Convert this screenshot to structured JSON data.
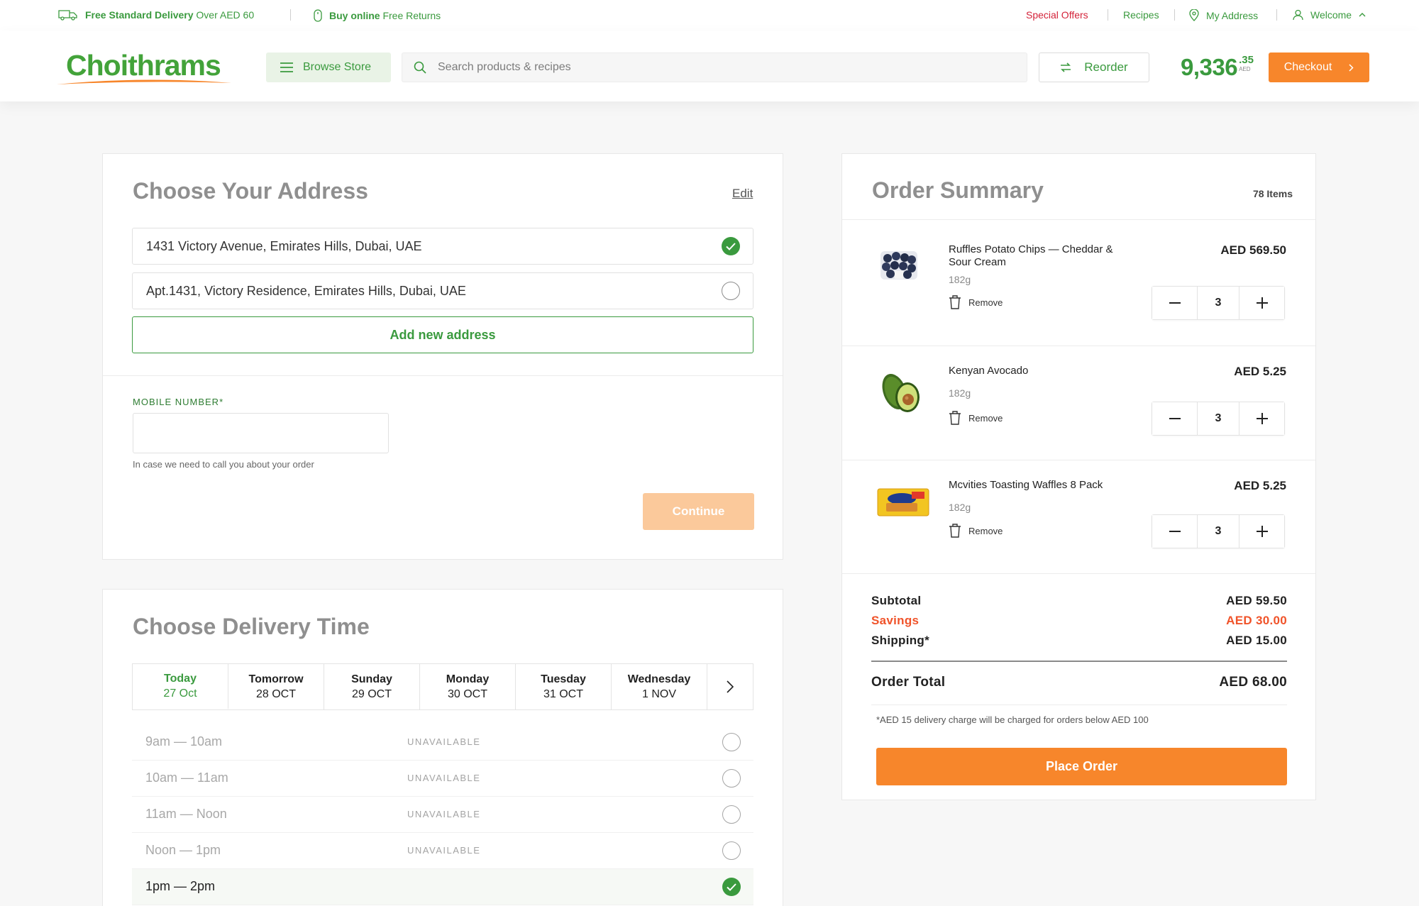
{
  "topbar": {
    "delivery_bold": "Free Standard Delivery",
    "delivery_rest": "Over AED 60",
    "returns_bold": "Buy online",
    "returns_rest": "Free Returns",
    "special_offers": "Special Offers",
    "recipes": "Recipes",
    "my_address": "My Address",
    "welcome": "Welcome"
  },
  "header": {
    "logo_text": "Choithrams",
    "browse_label": "Browse Store",
    "search_placeholder": "Search products & recipes",
    "reorder_label": "Reorder",
    "cart_amount": "9,336",
    "cart_cents": ".35",
    "cart_currency": "AED",
    "checkout_label": "Checkout"
  },
  "address": {
    "title": "Choose Your Address",
    "edit_label": "Edit",
    "options": [
      {
        "text": "1431 Victory Avenue, Emirates Hills, Dubai, UAE",
        "selected": true
      },
      {
        "text": "Apt.1431, Victory Residence, Emirates Hills, Dubai, UAE",
        "selected": false
      }
    ],
    "add_new_label": "Add new address",
    "mobile_label": "MOBILE NUMBER*",
    "mobile_value": "",
    "mobile_hint": "In case we need to call you about your order",
    "continue_label": "Continue"
  },
  "delivery": {
    "title": "Choose Delivery Time",
    "days": [
      {
        "name": "Today",
        "date": "27 Oct",
        "active": true
      },
      {
        "name": "Tomorrow",
        "date": "28 OCT",
        "active": false
      },
      {
        "name": "Sunday",
        "date": "29 OCT",
        "active": false
      },
      {
        "name": "Monday",
        "date": "30 OCT",
        "active": false
      },
      {
        "name": "Tuesday",
        "date": "31 OCT",
        "active": false
      },
      {
        "name": "Wednesday",
        "date": "1 NOV",
        "active": false
      }
    ],
    "slots": [
      {
        "time": "9am — 10am",
        "status": "UNAVAILABLE",
        "selected": false
      },
      {
        "time": "10am — 11am",
        "status": "UNAVAILABLE",
        "selected": false
      },
      {
        "time": "11am — Noon",
        "status": "UNAVAILABLE",
        "selected": false
      },
      {
        "time": "Noon — 1pm",
        "status": "UNAVAILABLE",
        "selected": false
      },
      {
        "time": "1pm — 2pm",
        "status": "",
        "selected": true
      }
    ]
  },
  "summary": {
    "title": "Order Summary",
    "item_count": "78 Items",
    "remove_label": "Remove",
    "products": [
      {
        "name": "Ruffles Potato Chips — Cheddar & Sour Cream",
        "weight": "182g",
        "price": "AED 569.50",
        "qty": "3",
        "image": "blueberries"
      },
      {
        "name": "Kenyan Avocado",
        "weight": "182g",
        "price": "AED 5.25",
        "qty": "3",
        "image": "avocado"
      },
      {
        "name": "Mcvities Toasting Waffles 8 Pack",
        "weight": "182g",
        "price": "AED 5.25",
        "qty": "3",
        "image": "waffles"
      }
    ],
    "subtotal_label": "Subtotal",
    "subtotal_value": "AED 59.50",
    "savings_label": "Savings",
    "savings_value": "AED 30.00",
    "shipping_label": "Shipping*",
    "shipping_value": "AED 15.00",
    "total_label": "Order Total",
    "total_value": "AED 68.00",
    "note": "*AED 15 delivery charge will be charged for orders below AED 100",
    "place_order_label": "Place Order"
  },
  "colors": {
    "brand_green": "#3a9a3e",
    "accent_orange": "#f7862b",
    "savings_red": "#f0532a"
  }
}
